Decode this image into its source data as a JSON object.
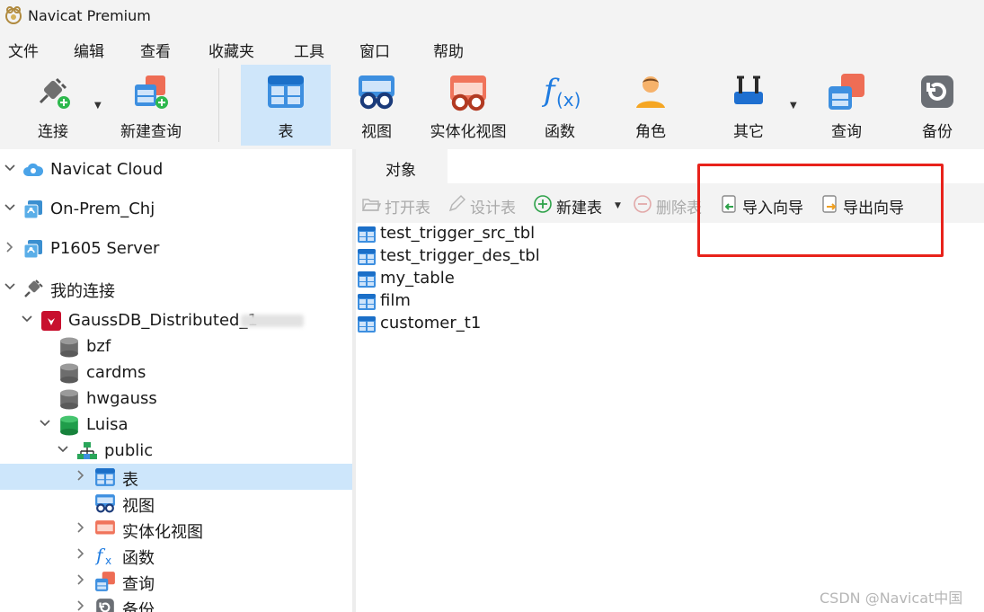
{
  "window": {
    "title": "Navicat Premium"
  },
  "menu": [
    "文件",
    "编辑",
    "查看",
    "收藏夹",
    "工具",
    "窗口",
    "帮助"
  ],
  "toolbar": {
    "connect": "连接",
    "new_query": "新建查询",
    "table": "表",
    "view": "视图",
    "materialized_view": "实体化视图",
    "function": "函数",
    "role": "角色",
    "other": "其它",
    "query": "查询",
    "backup": "备份"
  },
  "tree": {
    "cloud": "Navicat Cloud",
    "onprem": "On-Prem_Chj",
    "p1605": "P1605 Server",
    "my_connections": "我的连接",
    "gaussdb": "GaussDB_Distributed_1",
    "databases": [
      "bzf",
      "cardms",
      "hwgauss"
    ],
    "luisa": "Luisa",
    "public": "public",
    "schema_items": {
      "table": "表",
      "view": "视图",
      "materialized_view": "实体化视图",
      "function": "函数",
      "query": "查询",
      "backup": "备份"
    }
  },
  "tabs": {
    "objects": "对象"
  },
  "object_toolbar": {
    "open_table": "打开表",
    "design_table": "设计表",
    "new_table": "新建表",
    "delete_table": "删除表",
    "import_wizard": "导入向导",
    "export_wizard": "导出向导"
  },
  "objects": [
    "test_trigger_src_tbl",
    "test_trigger_des_tbl",
    "my_table",
    "film",
    "customer_t1"
  ],
  "watermark": "CSDN @Navicat中国",
  "colors": {
    "selection": "#cde6fb",
    "toolbar_active": "#cfe6fa",
    "highlight": "#e8221b",
    "accent_blue": "#1e88e5"
  }
}
